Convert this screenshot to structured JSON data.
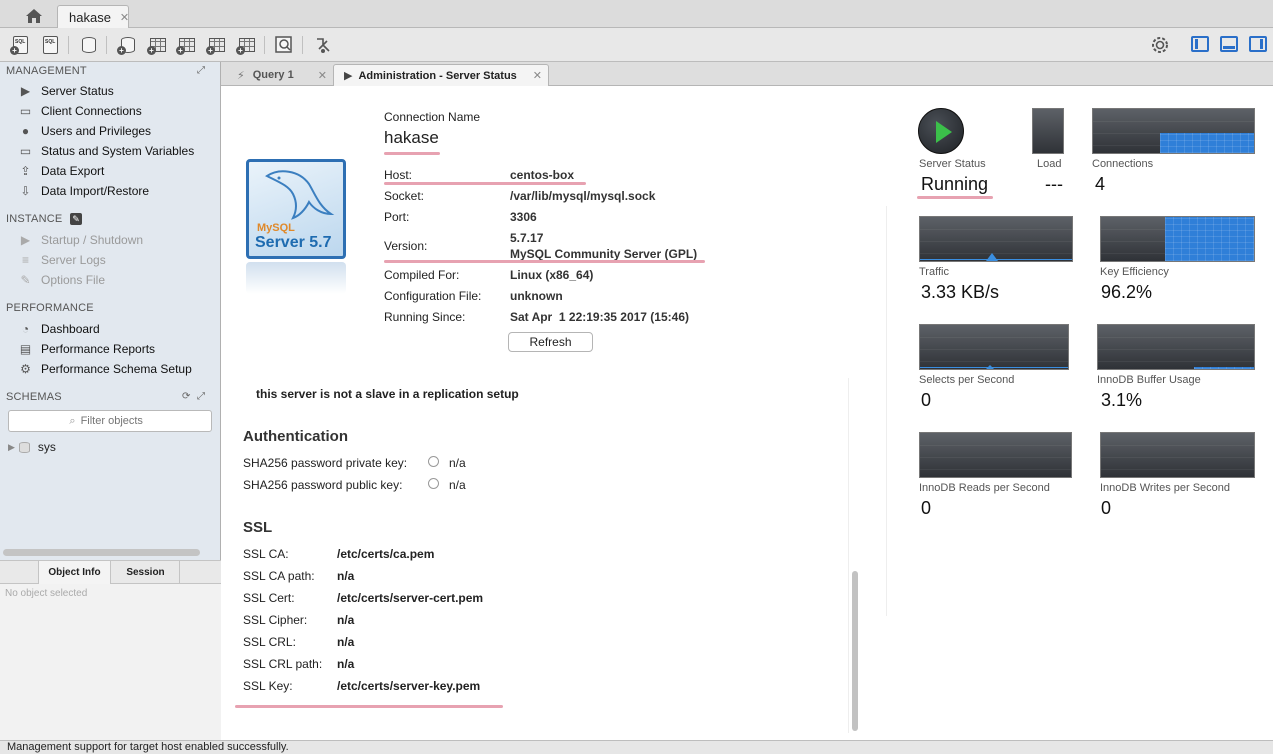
{
  "topbar": {
    "connection_tab": "hakase",
    "close_glyph": "✕"
  },
  "toolbar": {
    "icons": [
      "new-sql-tab-icon",
      "open-sql-script-icon",
      "inspector-icon",
      "create-schema-icon",
      "create-table-icon",
      "create-view-icon",
      "create-procedure-icon",
      "create-function-icon",
      "search-table-data-icon",
      "reconnect-icon",
      "settings-icon",
      "toggle-sidebar-icon",
      "toggle-output-icon",
      "toggle-secondary-sidebar-icon"
    ]
  },
  "sidebar": {
    "management_title": "MANAGEMENT",
    "management_items": [
      "Server Status",
      "Client Connections",
      "Users and Privileges",
      "Status and System Variables",
      "Data Export",
      "Data Import/Restore"
    ],
    "instance_title": "INSTANCE",
    "instance_items": [
      "Startup / Shutdown",
      "Server Logs",
      "Options File"
    ],
    "performance_title": "PERFORMANCE",
    "performance_items": [
      "Dashboard",
      "Performance Reports",
      "Performance Schema Setup"
    ],
    "schemas_title": "SCHEMAS",
    "filter_placeholder": "Filter objects",
    "schemas": [
      "sys"
    ],
    "info_tabs": [
      "Object Info",
      "Session"
    ],
    "no_object": "No object selected"
  },
  "main_tabs": [
    {
      "label": "Query 1"
    },
    {
      "label": "Administration - Server Status"
    }
  ],
  "server": {
    "connection_name_label": "Connection Name",
    "connection_name": "hakase",
    "logo_line1": "MySQL",
    "logo_line2": "Server 5.7",
    "host_label": "Host:",
    "host": "centos-box",
    "socket_label": "Socket:",
    "socket": "/var/lib/mysql/mysql.sock",
    "port_label": "Port:",
    "port": "3306",
    "version_label": "Version:",
    "version": "5.7.17",
    "version_detail": "MySQL Community Server (GPL)",
    "compiled_label": "Compiled For:",
    "compiled": "Linux   (x86_64)",
    "config_label": "Configuration File:",
    "config": "unknown",
    "running_since_label": "Running Since:",
    "running_since": "Sat Apr  1 22:19:35 2017 (15:46)",
    "refresh_label": "Refresh"
  },
  "replication_note": "this server is not a slave in a replication setup",
  "authentication": {
    "title": "Authentication",
    "private_key_label": "SHA256 password private key:",
    "private_key": "n/a",
    "public_key_label": "SHA256 password public key:",
    "public_key": "n/a"
  },
  "ssl": {
    "title": "SSL",
    "rows": [
      {
        "label": "SSL CA:",
        "value": "/etc/certs/ca.pem"
      },
      {
        "label": "SSL CA path:",
        "value": "n/a"
      },
      {
        "label": "SSL Cert:",
        "value": "/etc/certs/server-cert.pem"
      },
      {
        "label": "SSL Cipher:",
        "value": "n/a"
      },
      {
        "label": "SSL CRL:",
        "value": "n/a"
      },
      {
        "label": "SSL CRL path:",
        "value": "n/a"
      },
      {
        "label": "SSL Key:",
        "value": "/etc/certs/server-key.pem"
      }
    ]
  },
  "metrics": {
    "server_status": {
      "label": "Server Status",
      "value": "Running"
    },
    "load": {
      "label": "Load",
      "value": "---"
    },
    "connections": {
      "label": "Connections",
      "value": "4"
    },
    "traffic": {
      "label": "Traffic",
      "value": "3.33 KB/s"
    },
    "key_efficiency": {
      "label": "Key Efficiency",
      "value": "96.2%"
    },
    "selects": {
      "label": "Selects per Second",
      "value": "0"
    },
    "innodb_buffer": {
      "label": "InnoDB Buffer Usage",
      "value": "3.1%"
    },
    "innodb_reads": {
      "label": "InnoDB Reads per Second",
      "value": "0"
    },
    "innodb_writes": {
      "label": "InnoDB Writes per Second",
      "value": "0"
    }
  },
  "colors": {
    "accent": "#2f7fd8",
    "running": "#3bc04a",
    "underline": "#e7a2b1"
  },
  "statusbar": {
    "message": "Management support for target host enabled successfully."
  }
}
